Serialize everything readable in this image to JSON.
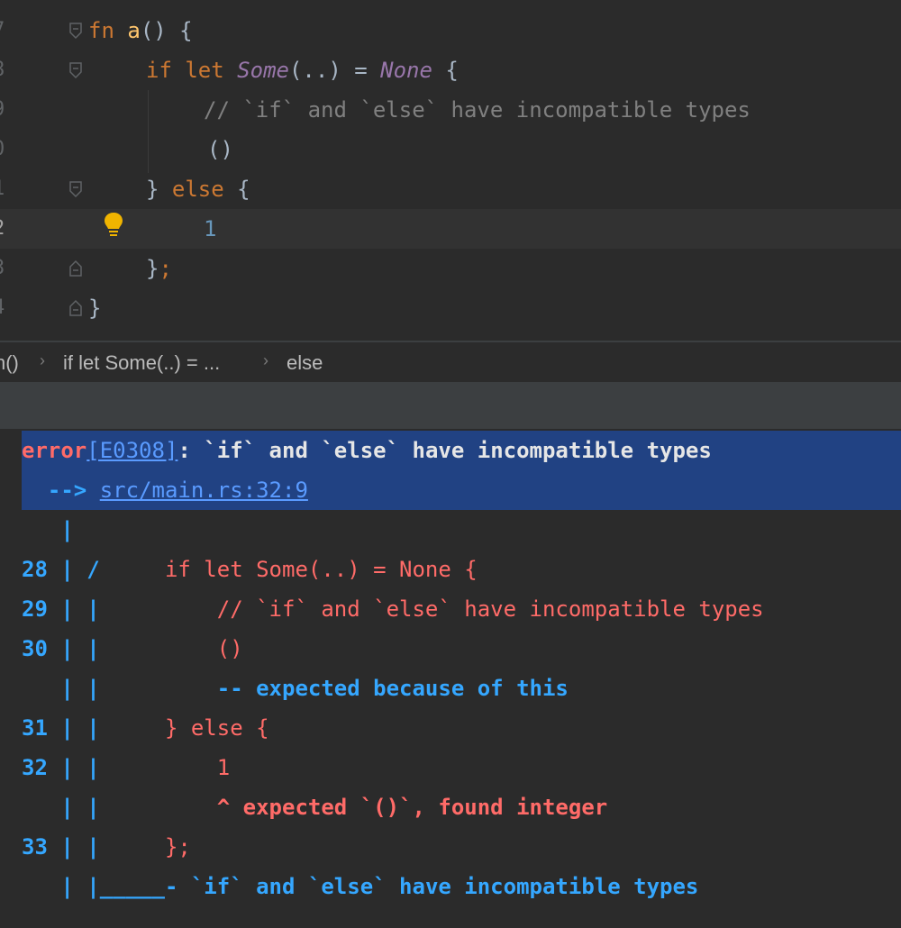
{
  "editor": {
    "line_numbers": [
      "7",
      "8",
      "9",
      "0",
      "1",
      "2",
      "3",
      "4"
    ],
    "lines": [
      {
        "kw1": "fn",
        "name": "a",
        "rest": "() {"
      },
      {
        "kw1": "if",
        "kw2": "let",
        "enum1": "Some",
        "mid": "(..) = ",
        "enum2": "None",
        "tail": " {"
      },
      {
        "comment": "// `if` and `else` have incompatible types"
      },
      {
        "text": "()"
      },
      {
        "brace": "} ",
        "kw1": "else",
        "tail": " {"
      },
      {
        "number": "1"
      },
      {
        "text": "};"
      },
      {
        "text": "}"
      }
    ]
  },
  "breadcrumb": {
    "items": [
      "n()",
      "if let Some(..) = ...",
      "else"
    ]
  },
  "console": {
    "header": {
      "error_word": "error",
      "code": "[E0308]",
      "message": ": `if` and `else` have incompatible types",
      "arrow": "  --> ",
      "location": "src/main.rs:32:9"
    },
    "lines": [
      {
        "prefix": "   |",
        "content": "",
        "cls": "blue"
      },
      {
        "prefix": "28 | /",
        "content": "     if let Some(..) = None {",
        "cls": "red-n"
      },
      {
        "prefix": "29 | |",
        "content": "         // `if` and `else` have incompatible types",
        "cls": "red-n"
      },
      {
        "prefix": "30 | |",
        "content": "         ()",
        "cls": "red-n"
      },
      {
        "prefix": "   | |",
        "content": "         -- expected because of this",
        "cls": "blue"
      },
      {
        "prefix": "31 | |",
        "content": "     } else {",
        "cls": "red-n"
      },
      {
        "prefix": "32 | |",
        "content": "         1",
        "cls": "red-n"
      },
      {
        "prefix": "   | |",
        "content": "         ^ expected `()`, found integer",
        "cls": "red"
      },
      {
        "prefix": "33 | |",
        "content": "     };",
        "cls": "red-n"
      },
      {
        "prefix": "   | |_____",
        "content": "- `if` and `else` have incompatible types",
        "cls": "blue"
      }
    ]
  },
  "colors": {
    "background": "#2b2b2b",
    "keyword": "#cc7832",
    "function": "#ffc66d",
    "enum": "#9876aa",
    "comment": "#808080",
    "number": "#6897bb",
    "error_red": "#ff6b68",
    "info_blue": "#35a7ff",
    "selection": "#214283"
  }
}
